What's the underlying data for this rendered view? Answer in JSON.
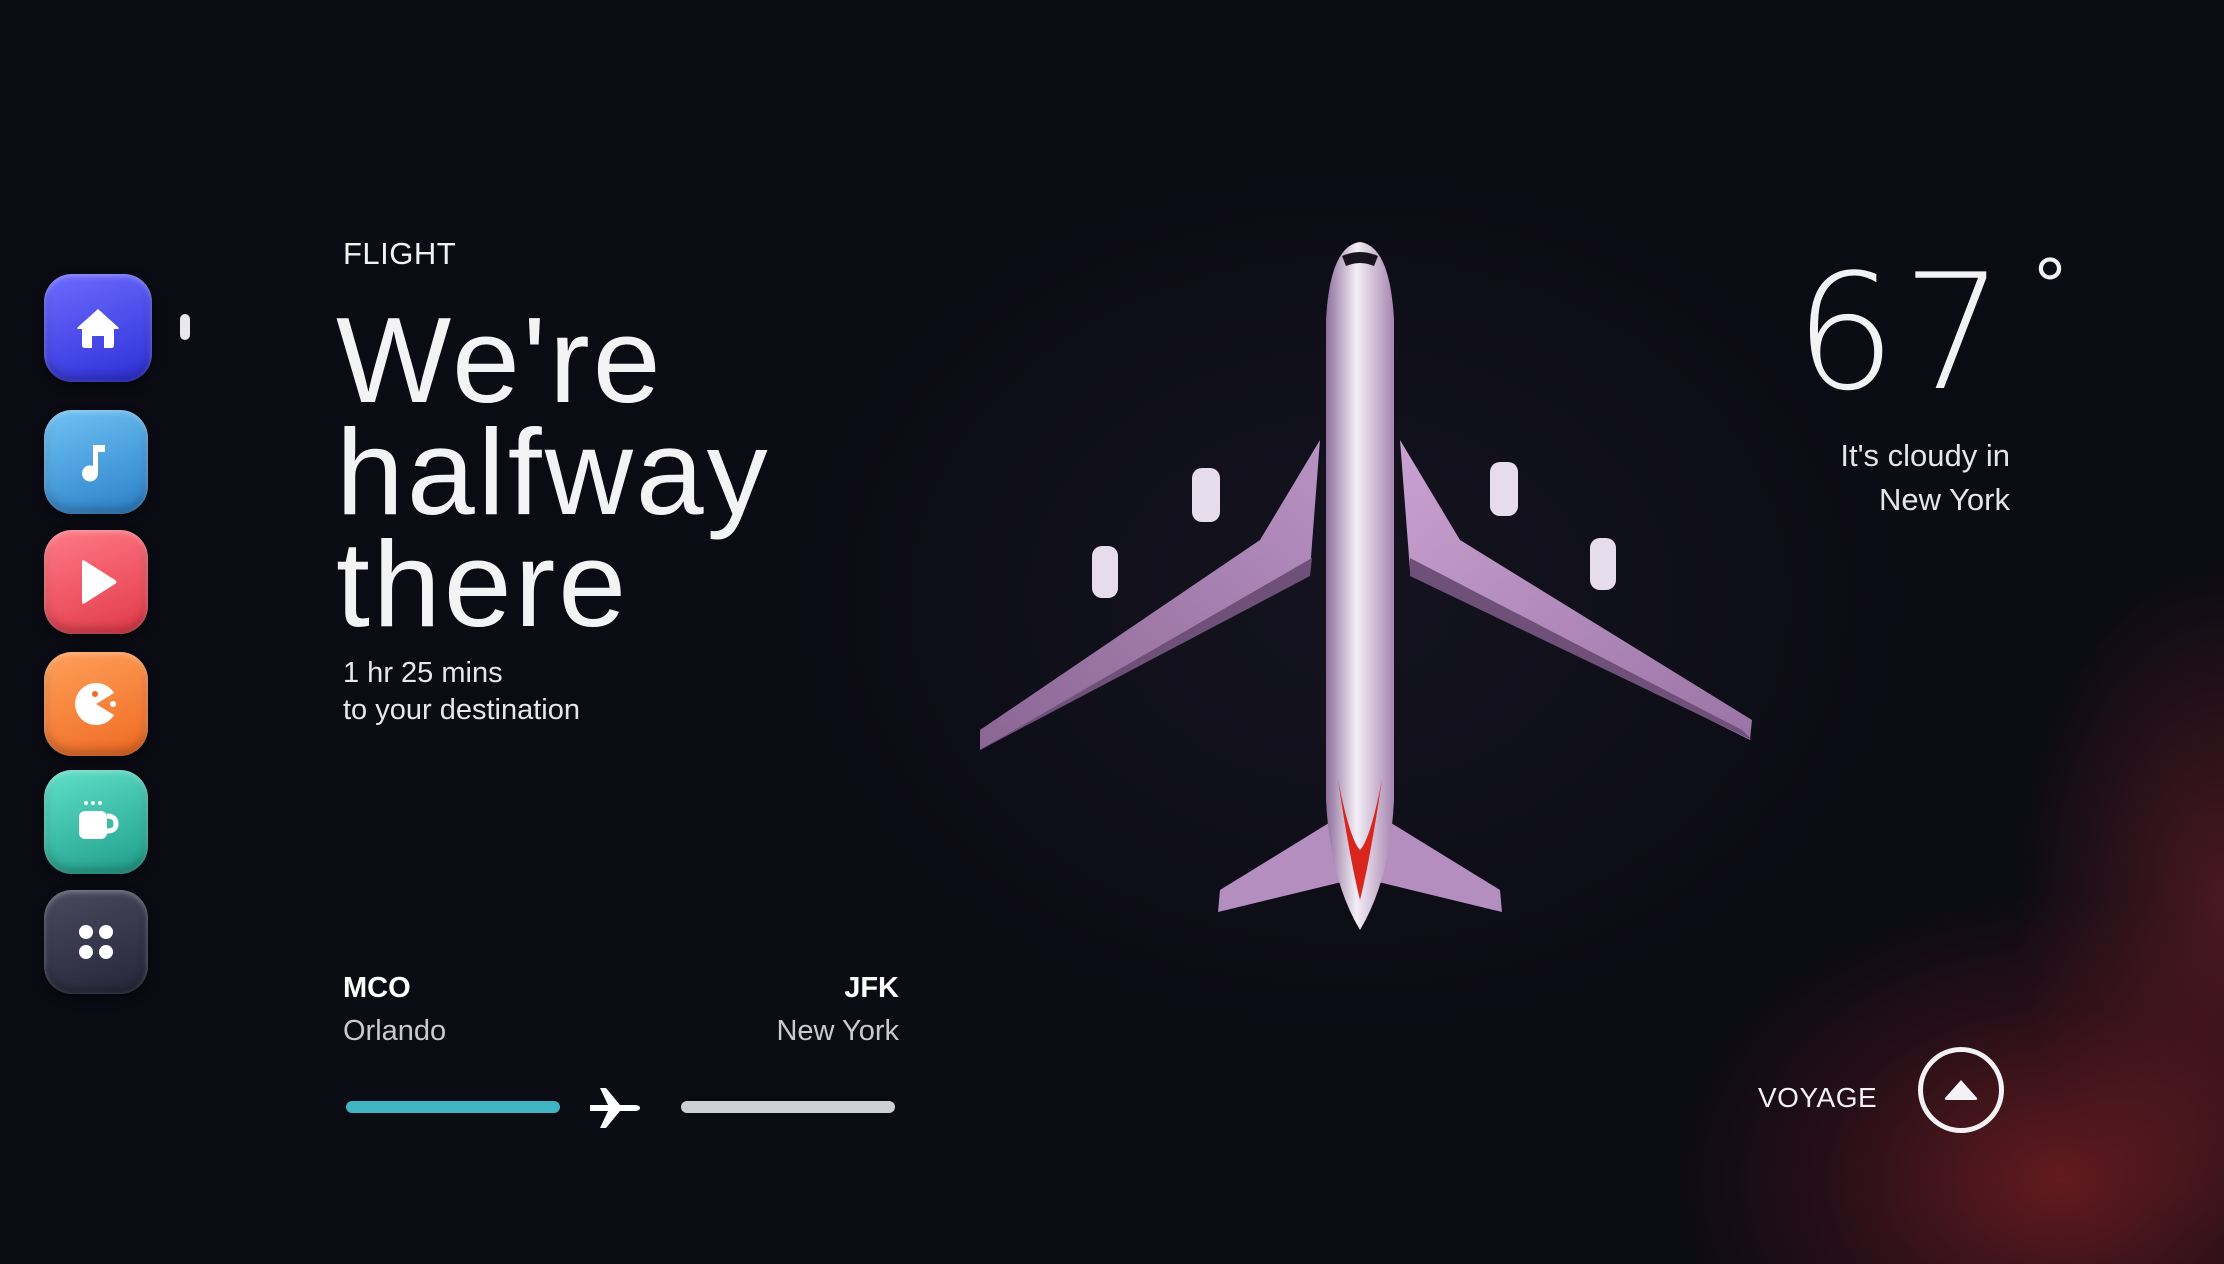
{
  "dock": {
    "apps": [
      {
        "name": "home",
        "icon": "home-icon",
        "color": "#4b4cf0"
      },
      {
        "name": "music",
        "icon": "music-note-icon",
        "color": "#3d97d9"
      },
      {
        "name": "video",
        "icon": "play-icon",
        "color": "#ef4a57"
      },
      {
        "name": "game",
        "icon": "pacman-icon",
        "color": "#f47a2e"
      },
      {
        "name": "coffee",
        "icon": "coffee-cup-icon",
        "color": "#2db6a0"
      },
      {
        "name": "apps",
        "icon": "grid-icon",
        "color": "#34344a"
      }
    ]
  },
  "flight": {
    "section_label": "FLIGHT",
    "headline_lines": [
      "We're",
      "halfway",
      "there"
    ],
    "eta_lines": [
      "1 hr 25 mins",
      "to your destination"
    ],
    "origin": {
      "code": "MCO",
      "city": "Orlando"
    },
    "destination": {
      "code": "JFK",
      "city": "New York"
    },
    "progress_fraction": 0.5,
    "progress_color": "#3fb4c2"
  },
  "weather": {
    "temperature": "67",
    "degree_symbol": "°",
    "description_lines": [
      "It's cloudy in",
      "New York"
    ]
  },
  "voyage": {
    "label": "VOYAGE",
    "button_icon": "chevron-up-icon"
  }
}
